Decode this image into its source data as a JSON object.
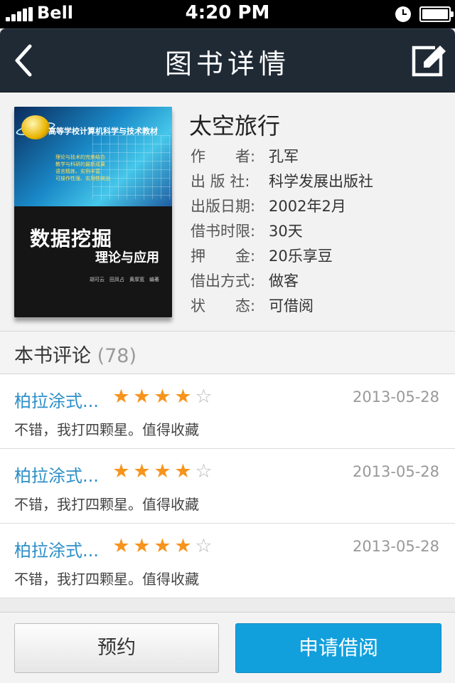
{
  "status_bar": {
    "carrier": "Bell",
    "time": "4:20 PM"
  },
  "nav": {
    "title": "图书详情",
    "bar_color": "#1f2a35"
  },
  "book": {
    "title": "太空旅行",
    "details": [
      {
        "label": "作　　者:",
        "value": "孔军"
      },
      {
        "label": "出 版 社:",
        "value": "科学发展出版社"
      },
      {
        "label": "出版日期:",
        "value": "2002年2月"
      },
      {
        "label": "借书时限:",
        "value": "30天"
      },
      {
        "label": "押　　金:",
        "value": "20乐享豆"
      },
      {
        "label": "借出方式:",
        "value": "做客"
      },
      {
        "label": "状　　态:",
        "value": "可借阅"
      }
    ],
    "cover": {
      "series": "高等学校计算机科学与技术教材",
      "bullets": [
        "理论与技术的完美结合",
        "教学与科研的最新成果",
        "语言精炼、实例丰富",
        "可操作性强、实用性突出"
      ],
      "title": "数据挖掘",
      "subtitle": "理论与应用",
      "authors": "胡可云　田凤占　黄厚宽　编著"
    }
  },
  "comments": {
    "title": "本书评论",
    "count": "(78)",
    "items": [
      {
        "user": "柏拉涂式...",
        "rating": 4,
        "max_rating": 5,
        "date": "2013-05-28",
        "text": "不错，我打四颗星。值得收藏"
      },
      {
        "user": "柏拉涂式...",
        "rating": 4,
        "max_rating": 5,
        "date": "2013-05-28",
        "text": "不错，我打四颗星。值得收藏"
      },
      {
        "user": "柏拉涂式...",
        "rating": 4,
        "max_rating": 5,
        "date": "2013-05-28",
        "text": "不错，我打四颗星。值得收藏"
      }
    ]
  },
  "actions": {
    "reserve_label": "预约",
    "borrow_label": "申请借阅",
    "borrow_color": "#12a0dd"
  },
  "colors": {
    "link": "#2b8fc8",
    "star": "#f7941d"
  }
}
